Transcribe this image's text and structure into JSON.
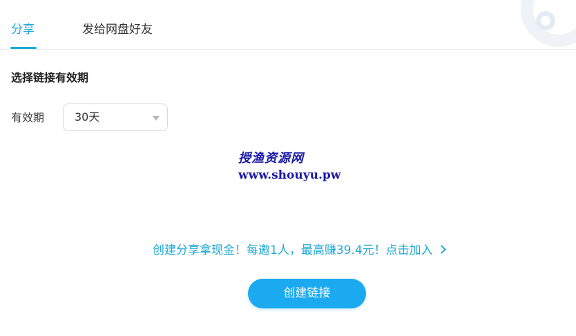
{
  "tabs": [
    {
      "label": "分享",
      "active": true
    },
    {
      "label": "发给网盘好友",
      "active": false
    }
  ],
  "section": {
    "title": "选择链接有效期"
  },
  "validity": {
    "label": "有效期",
    "selected": "30天"
  },
  "watermark": {
    "cn": "授渔资源网",
    "url": "www.shouyu.pw"
  },
  "promo": {
    "text": "创建分享拿现金！每邀1人，最高赚39.4元！点击加入"
  },
  "actions": {
    "create_link": "创建链接"
  },
  "colors": {
    "accent": "#1da8d6",
    "button": "#1ba9f0",
    "watermark": "#1a1aa6"
  }
}
